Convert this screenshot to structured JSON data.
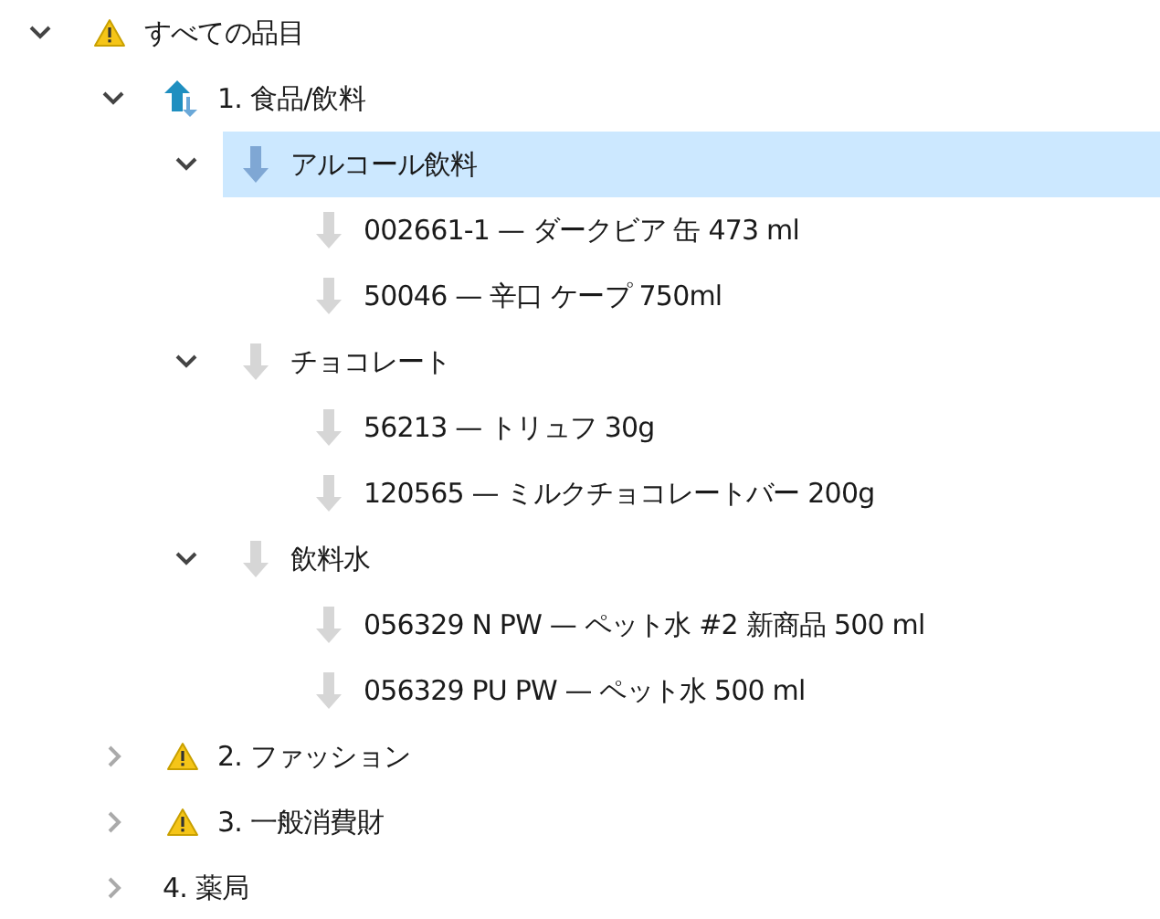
{
  "tree": [
    {
      "label": "すべての品目",
      "kind": "warning",
      "expanded": true,
      "selected": false,
      "children": [
        {
          "label": "1. 食品/飲料",
          "kind": "sync",
          "expanded": true,
          "selected": false,
          "children": [
            {
              "label": "アルコール飲料",
              "kind": "active",
              "expanded": true,
              "selected": true,
              "children": [
                {
                  "label": "002661-1 — ダークビア 缶 473 ml",
                  "kind": "inactive",
                  "selected": false
                },
                {
                  "label": "50046 — 辛口 ケープ 750ml",
                  "kind": "inactive",
                  "selected": false
                }
              ]
            },
            {
              "label": "チョコレート",
              "kind": "inactive",
              "expanded": true,
              "selected": false,
              "children": [
                {
                  "label": "56213 — トリュフ 30g",
                  "kind": "inactive",
                  "selected": false
                },
                {
                  "label": "120565 — ミルクチョコレートバー 200g",
                  "kind": "inactive",
                  "selected": false
                }
              ]
            },
            {
              "label": "飲料水",
              "kind": "inactive",
              "expanded": true,
              "selected": false,
              "children": [
                {
                  "label": "056329 N PW — ペット水 #2 新商品 500 ml",
                  "kind": "inactive",
                  "selected": false
                },
                {
                  "label": "056329 PU PW — ペット水 500 ml",
                  "kind": "inactive",
                  "selected": false
                }
              ]
            }
          ]
        },
        {
          "label": "2. ファッション",
          "kind": "warning",
          "expanded": false,
          "selected": false
        },
        {
          "label": "3. 一般消費財",
          "kind": "warning",
          "expanded": false,
          "selected": false
        },
        {
          "label": "4. 薬局",
          "kind": "plain",
          "expanded": false,
          "selected": false
        }
      ]
    }
  ]
}
